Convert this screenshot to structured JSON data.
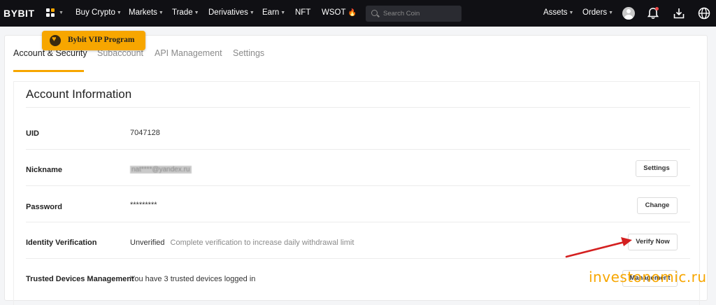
{
  "topbar": {
    "logo": "BYBIT",
    "nav": [
      {
        "label": "Buy Crypto",
        "caret": true
      },
      {
        "label": "Markets",
        "caret": true
      },
      {
        "label": "Trade",
        "caret": true
      },
      {
        "label": "Derivatives",
        "caret": true
      },
      {
        "label": "Earn",
        "caret": true
      },
      {
        "label": "NFT",
        "caret": false
      },
      {
        "label": "WSOT",
        "caret": false
      }
    ],
    "search_placeholder": "Search Coin",
    "right_nav": [
      {
        "label": "Assets"
      },
      {
        "label": "Orders"
      }
    ],
    "icons": [
      "avatar-icon",
      "bell-icon",
      "download-icon",
      "globe-icon"
    ],
    "notification_dot_color": "#f04a4a"
  },
  "tooltip": {
    "label": "Bybit VIP Program"
  },
  "tabs": [
    {
      "label": "Account & Security",
      "active": true
    },
    {
      "label": "Subaccount",
      "active": false
    },
    {
      "label": "API Management",
      "active": false
    },
    {
      "label": "Settings",
      "active": false
    }
  ],
  "section": {
    "title": "Account Information",
    "rows": [
      {
        "label": "UID",
        "value": "7047128"
      },
      {
        "label": "Nickname",
        "value": "nat****@yandex.ru",
        "button": "Settings"
      },
      {
        "label": "Password",
        "value": "*********",
        "button": "Change"
      },
      {
        "label": "Identity Verification",
        "value": "Unverified",
        "note": "Complete verification to increase daily withdrawal limit",
        "button": "Verify Now"
      },
      {
        "label": "Trusted Devices Management",
        "value": "You have 3 trusted devices logged in",
        "button": "Management"
      }
    ]
  },
  "watermark": "investonomic.ru",
  "colors": {
    "accent": "#f7a600",
    "topbar": "#101014",
    "arrow": "#d42020"
  }
}
